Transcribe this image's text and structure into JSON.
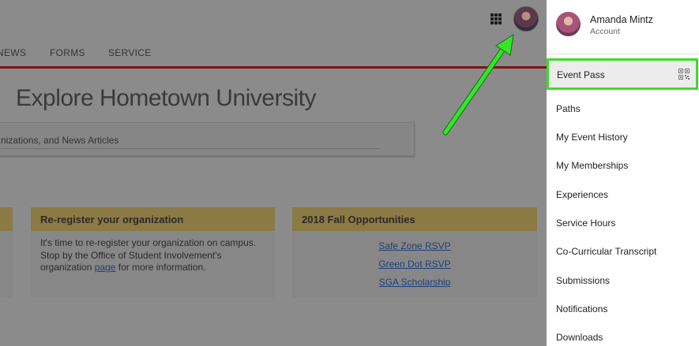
{
  "header": {
    "apps_icon": "apps-grid-icon",
    "avatar_icon": "user-avatar"
  },
  "nav": {
    "items": [
      "NEWS",
      "FORMS",
      "SERVICE"
    ]
  },
  "hero": {
    "title": "Explore Hometown University",
    "search_placeholder": "nizations, and News Articles"
  },
  "cards": {
    "reregister": {
      "title": "Re-register your organization",
      "text_before": "It's time to re-register your organization on campus. Stop by the Office of Student Involvement's organization ",
      "link": "page",
      "text_after": " for more information."
    },
    "opportunities": {
      "title": "2018 Fall Opportunities",
      "links": [
        "Safe Zone RSVP",
        "Green Dot RSVP",
        "SGA Scholarship"
      ]
    }
  },
  "menu": {
    "user_name": "Amanda Mintz",
    "user_sub": "Account",
    "event_pass": "Event Pass",
    "items": [
      "Paths",
      "My Event History",
      "My Memberships",
      "Experiences",
      "Service Hours",
      "Co-Curricular Transcript",
      "Submissions",
      "Notifications",
      "Downloads"
    ]
  },
  "colors": {
    "highlight": "#3ddc2a",
    "arrow": "#33e62a"
  }
}
